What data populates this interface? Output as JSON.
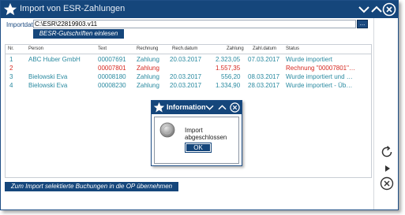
{
  "window": {
    "title": "Import von ESR-Zahlungen"
  },
  "import": {
    "label": "Importdat",
    "value": "C:\\ESR\\22819903.v11",
    "browse": "...",
    "esr_button": "BESR-Gutschriften einlesen"
  },
  "grid": {
    "headers": [
      "Nr.",
      "Person",
      "Text",
      "Rechnung",
      "Rech.datum",
      "Zahlung",
      "Zahl.datum",
      "Status"
    ],
    "rows": [
      {
        "nr": "1",
        "person": "ABC Huber GmbH",
        "text": "00007691",
        "rechnung": "Zahlung",
        "rechdatum": "20.03.2017",
        "zahlung": "2.323,05",
        "zahldatum": "07.03.2017",
        "status": "Wurde importiert",
        "color": "teal"
      },
      {
        "nr": "2",
        "person": "",
        "text": "00007801",
        "rechnung": "Zahlung",
        "rechdatum": "",
        "zahlung": "1.557,35",
        "zahldatum": "",
        "status": "Rechnung \"00007801\"…",
        "color": "red"
      },
      {
        "nr": "3",
        "person": "Bielowski Eva",
        "text": "00008180",
        "rechnung": "Zahlung",
        "rechdatum": "20.03.2017",
        "zahlung": "556,20",
        "zahldatum": "08.03.2017",
        "status": "Wurde importiert und …",
        "color": "teal"
      },
      {
        "nr": "4",
        "person": "Bielowski Eva",
        "text": "00008230",
        "rechnung": "Zahlung",
        "rechdatum": "20.03.2017",
        "zahlung": "1.334,90",
        "zahldatum": "28.03.2017",
        "status": "Wurde importiert - Üb…",
        "color": "teal"
      }
    ]
  },
  "bottom_button": "Zum Import selektierte Buchungen in die OP übernehmen",
  "dialog": {
    "title": "Information",
    "message": "Import abgeschlossen",
    "ok": "OK"
  },
  "colors": {
    "titlebar": "#15467b",
    "teal": "#2a8aa0",
    "red": "#d62820"
  },
  "icons": [
    "star-icon",
    "chevron-down-icon",
    "chevron-up-icon",
    "close-icon",
    "refresh-icon",
    "play-icon",
    "info-icon"
  ]
}
